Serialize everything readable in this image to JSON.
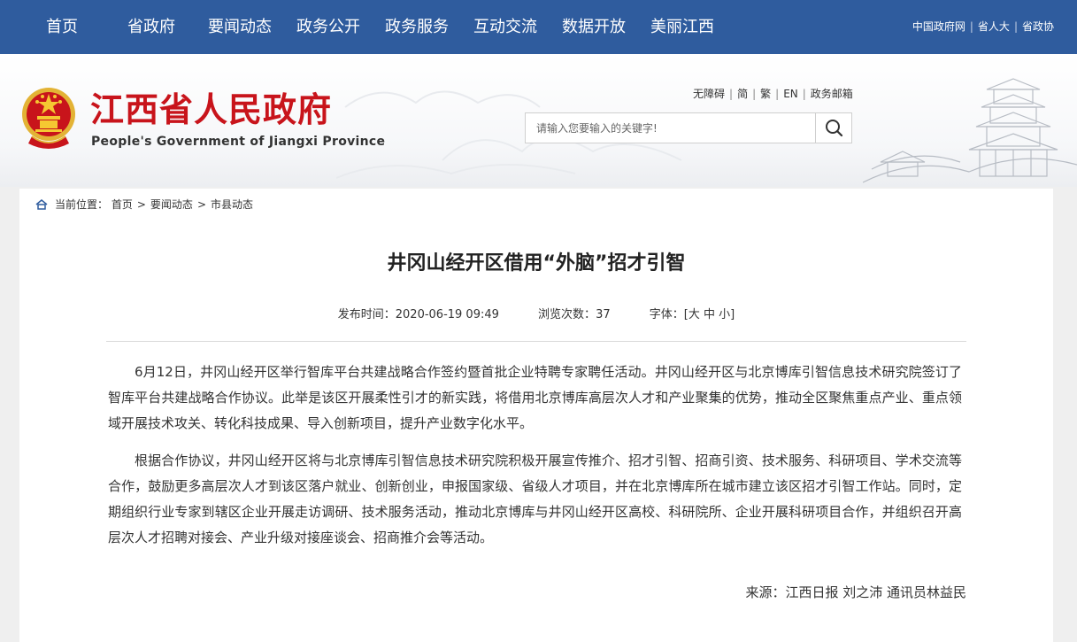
{
  "topnav": {
    "items": [
      "首页",
      "省政府",
      "要闻动态",
      "政务公开",
      "政务服务",
      "互动交流",
      "数据开放",
      "美丽江西"
    ],
    "quick_links": [
      "中国政府网",
      "省人大",
      "省政协"
    ]
  },
  "header": {
    "site_name_cn": "江西省人民政府",
    "site_name_en": "People's Government of Jiangxi Province",
    "tools": [
      "无障碍",
      "简",
      "繁",
      "EN",
      "政务邮箱"
    ],
    "search_placeholder": "请输入您要输入的关键字!",
    "icons": [
      "national-emblem-icon",
      "search-icon",
      "pavilion-icon"
    ],
    "accent_color": "#c8141b",
    "nav_color": "#2f5c9e"
  },
  "breadcrumb": {
    "prefix": "当前位置：",
    "items": [
      "首页",
      "要闻动态",
      "市县动态"
    ],
    "separator": ">"
  },
  "article": {
    "title": "井冈山经开区借用“外脑”招才引智",
    "publish_label": "发布时间：",
    "publish_time": "2020-06-19 09:49",
    "views_label": "浏览次数：",
    "views": "37",
    "font_label": "字体：",
    "font_bracket_open": "[",
    "font_large": "大",
    "font_medium": "中",
    "font_small": "小",
    "font_bracket_close": "]",
    "paragraphs": [
      "6月12日，井冈山经开区举行智库平台共建战略合作签约暨首批企业特聘专家聘任活动。井冈山经开区与北京博库引智信息技术研究院签订了智库平台共建战略合作协议。此举是该区开展柔性引才的新实践，将借用北京博库高层次人才和产业聚集的优势，推动全区聚焦重点产业、重点领域开展技术攻关、转化科技成果、导入创新项目，提升产业数字化水平。",
      "根据合作协议，井冈山经开区将与北京博库引智信息技术研究院积极开展宣传推介、招才引智、招商引资、技术服务、科研项目、学术交流等合作，鼓励更多高层次人才到该区落户就业、创新创业，申报国家级、省级人才项目，并在北京博库所在城市建立该区招才引智工作站。同时，定期组织行业专家到辖区企业开展走访调研、技术服务活动，推动北京博库与井冈山经开区高校、科研院所、企业开展科研项目合作，并组织召开高层次人才招聘对接会、产业升级对接座谈会、招商推介会等活动。"
    ],
    "source": "来源：江西日报 刘之沛 通讯员林益民"
  }
}
